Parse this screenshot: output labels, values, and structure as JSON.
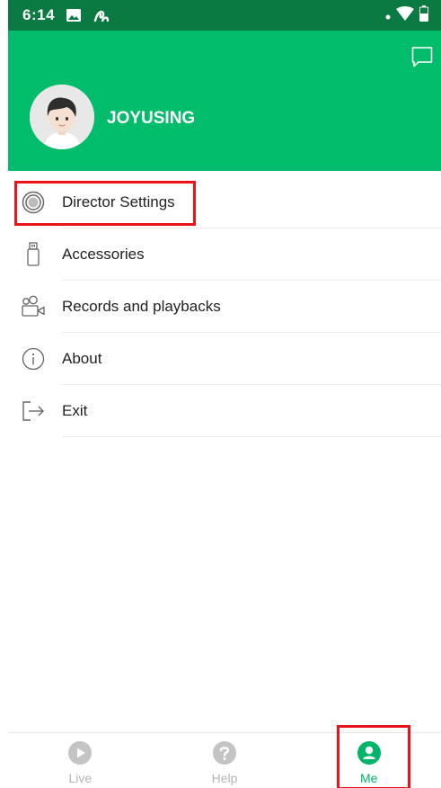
{
  "status_bar": {
    "time": "6:14",
    "icons": [
      "image-icon",
      "app-notification-icon",
      "signal-icon",
      "wifi-icon",
      "battery-icon"
    ]
  },
  "header": {
    "username": "JOYUSING",
    "icons": [
      "message-icon",
      "avatar"
    ],
    "background_color": "#00bc6b"
  },
  "menu": {
    "items": [
      {
        "label": "Director Settings",
        "icon": "director-icon"
      },
      {
        "label": "Accessories",
        "icon": "usb-drive-icon"
      },
      {
        "label": "Records and playbacks",
        "icon": "records-icon"
      },
      {
        "label": "About",
        "icon": "info-icon"
      },
      {
        "label": "Exit",
        "icon": "exit-icon"
      }
    ]
  },
  "bottom_nav": {
    "items": [
      {
        "label": "Live",
        "icon": "play-icon",
        "active": false
      },
      {
        "label": "Help",
        "icon": "help-icon",
        "active": false
      },
      {
        "label": "Me",
        "icon": "user-icon",
        "active": true
      }
    ],
    "active_color": "#00b46a",
    "inactive_color": "#c4c4c4"
  },
  "annotations": {
    "highlight_color": "#e8141b"
  }
}
